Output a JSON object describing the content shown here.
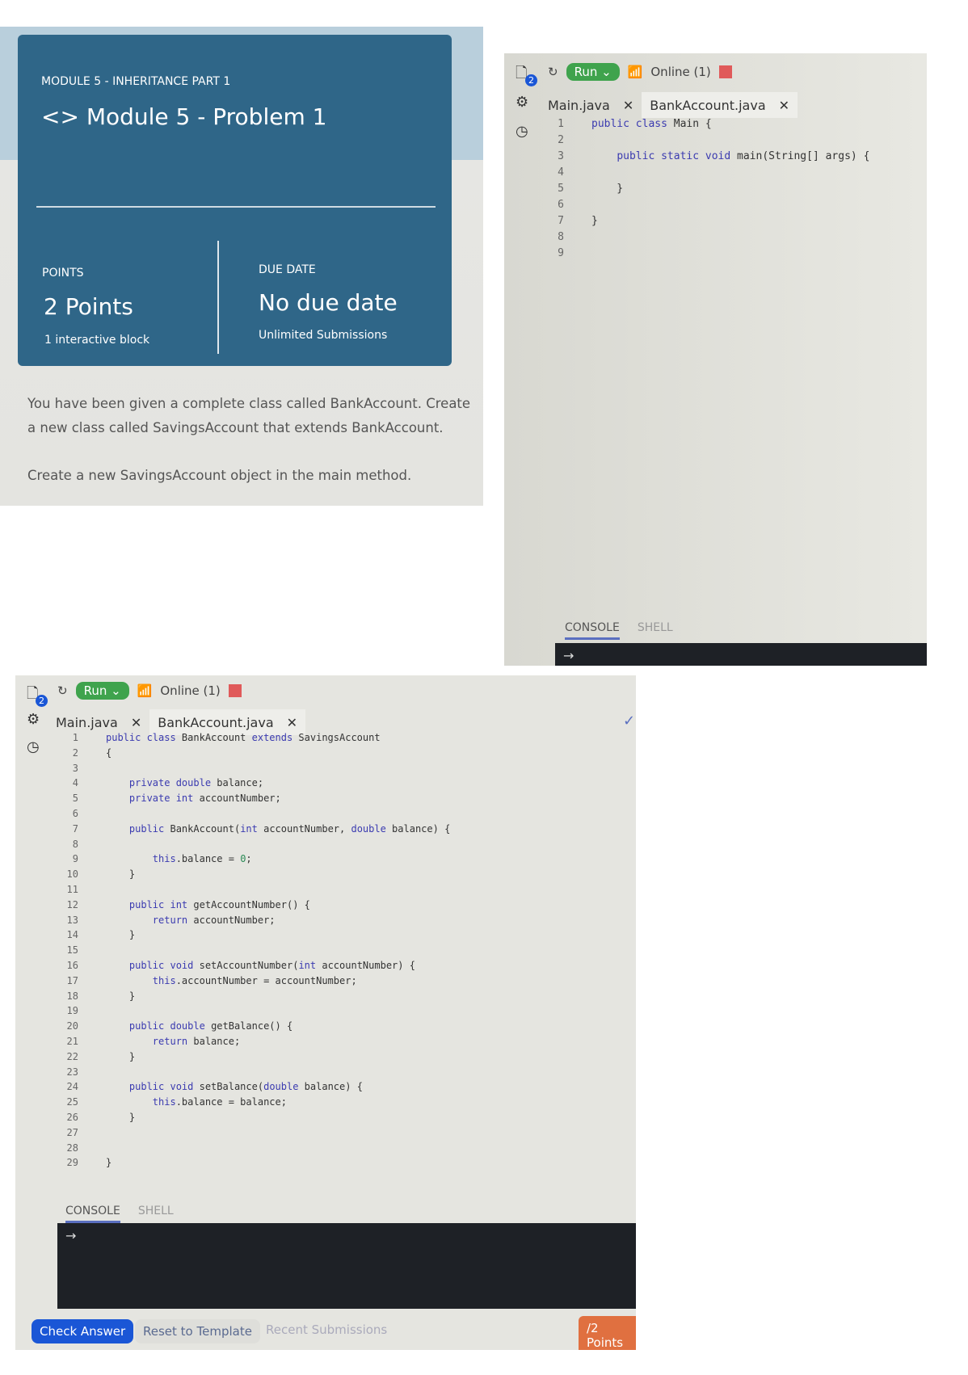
{
  "assignment": {
    "module": "MODULE 5 - INHERITANCE PART 1",
    "title_icon": "code-brackets-icon",
    "title_symbol": "<>",
    "title": "Module 5 - Problem 1",
    "points_label": "POINTS",
    "points_value": "2 Points",
    "points_sub": "1 interactive block",
    "due_label": "DUE DATE",
    "due_value": "No due date",
    "due_sub": "Unlimited Submissions",
    "desc1": "You have been given a complete class called BankAccount. Create",
    "desc2": "a new class called SavingsAccount that extends BankAccount.",
    "desc3": "Create a new SavingsAccount object in the main method.",
    "card_color": "#2f6688"
  },
  "ide": {
    "run_label": "Run",
    "status": "Online (1)",
    "files_badge": "2",
    "tabs": [
      "Main.java",
      "BankAccount.java"
    ],
    "close_symbol": "✕",
    "console_tab": "CONSOLE",
    "shell_tab": "SHELL",
    "prompt": "→",
    "check_answer": "Check Answer",
    "reset": "Reset to Template",
    "recent": "Recent Submissions",
    "score": "/2 Points",
    "colors": {
      "run": "#3fa34d",
      "stop": "#e05a5a",
      "check": "#1a56d6",
      "score": "#e07040"
    }
  },
  "main_code": [
    [
      [
        "k",
        "public class "
      ],
      [
        "t",
        "Main {"
      ]
    ],
    [],
    [
      [
        "t",
        "    "
      ],
      [
        "k",
        "public static void "
      ],
      [
        "t",
        "main(String[] args) {"
      ]
    ],
    [],
    [
      [
        "t",
        "    }"
      ]
    ],
    [],
    [
      [
        "t",
        "}"
      ]
    ],
    [],
    []
  ],
  "bank_code": [
    [
      [
        "k",
        "public class "
      ],
      [
        "t",
        "BankAccount "
      ],
      [
        "k",
        "extends "
      ],
      [
        "t",
        "SavingsAccount"
      ]
    ],
    [
      [
        "t",
        "{"
      ]
    ],
    [],
    [
      [
        "t",
        "    "
      ],
      [
        "k",
        "private double "
      ],
      [
        "t",
        "balance;"
      ]
    ],
    [
      [
        "t",
        "    "
      ],
      [
        "k",
        "private int "
      ],
      [
        "t",
        "accountNumber;"
      ]
    ],
    [],
    [
      [
        "t",
        "    "
      ],
      [
        "k",
        "public "
      ],
      [
        "t",
        "BankAccount("
      ],
      [
        "k",
        "int "
      ],
      [
        "t",
        "accountNumber, "
      ],
      [
        "k",
        "double "
      ],
      [
        "t",
        "balance) {"
      ]
    ],
    [],
    [
      [
        "t",
        "        "
      ],
      [
        "k",
        "this"
      ],
      [
        "t",
        ".balance = "
      ],
      [
        "n",
        "0"
      ],
      [
        "t",
        ";"
      ]
    ],
    [
      [
        "t",
        "    }"
      ]
    ],
    [],
    [
      [
        "t",
        "    "
      ],
      [
        "k",
        "public int "
      ],
      [
        "t",
        "getAccountNumber() {"
      ]
    ],
    [
      [
        "t",
        "        "
      ],
      [
        "k",
        "return "
      ],
      [
        "t",
        "accountNumber;"
      ]
    ],
    [
      [
        "t",
        "    }"
      ]
    ],
    [],
    [
      [
        "t",
        "    "
      ],
      [
        "k",
        "public void "
      ],
      [
        "t",
        "setAccountNumber("
      ],
      [
        "k",
        "int "
      ],
      [
        "t",
        "accountNumber) {"
      ]
    ],
    [
      [
        "t",
        "        "
      ],
      [
        "k",
        "this"
      ],
      [
        "t",
        ".accountNumber = accountNumber;"
      ]
    ],
    [
      [
        "t",
        "    }"
      ]
    ],
    [],
    [
      [
        "t",
        "    "
      ],
      [
        "k",
        "public double "
      ],
      [
        "t",
        "getBalance() {"
      ]
    ],
    [
      [
        "t",
        "        "
      ],
      [
        "k",
        "return "
      ],
      [
        "t",
        "balance;"
      ]
    ],
    [
      [
        "t",
        "    }"
      ]
    ],
    [],
    [
      [
        "t",
        "    "
      ],
      [
        "k",
        "public void "
      ],
      [
        "t",
        "setBalance("
      ],
      [
        "k",
        "double "
      ],
      [
        "t",
        "balance) {"
      ]
    ],
    [
      [
        "t",
        "        "
      ],
      [
        "k",
        "this"
      ],
      [
        "t",
        ".balance = balance;"
      ]
    ],
    [
      [
        "t",
        "    }"
      ]
    ],
    [],
    [],
    [
      [
        "t",
        "}"
      ]
    ]
  ]
}
